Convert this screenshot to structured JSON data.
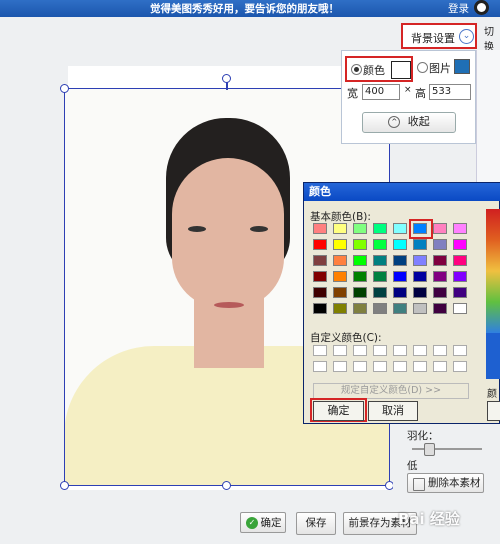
{
  "topbar": {
    "message": "觉得美图秀秀好用，要告诉您的朋友哦！",
    "login": "登录"
  },
  "bg_settings": {
    "button_label": "背景设置",
    "chevron": "⌄",
    "side_tab": "切换",
    "color_option": "颜色",
    "image_option": "图片",
    "width_label": "宽",
    "width_value": "400",
    "times": "×",
    "height_label": "高",
    "height_value": "533",
    "collapse_label": "收起"
  },
  "color_dialog": {
    "title": "颜色",
    "basic_label": "基本颜色(B):",
    "custom_label": "自定义颜色(C):",
    "define_label": "规定自定义颜色(D) >>",
    "ok_label": "确定",
    "cancel_label": "取消",
    "side_label": "颜色",
    "basic_colors": [
      "#ff8080",
      "#ffff80",
      "#80ff80",
      "#00ff80",
      "#80ffff",
      "#0080ff",
      "#ff80c0",
      "#ff80ff",
      "#ff0000",
      "#ffff00",
      "#80ff00",
      "#00ff40",
      "#00ffff",
      "#0080c0",
      "#8080c0",
      "#ff00ff",
      "#804040",
      "#ff8040",
      "#00ff00",
      "#008080",
      "#004080",
      "#8080ff",
      "#800040",
      "#ff0080",
      "#800000",
      "#ff8000",
      "#008000",
      "#008040",
      "#0000ff",
      "#0000a0",
      "#800080",
      "#8000ff",
      "#400000",
      "#804000",
      "#004000",
      "#004040",
      "#000080",
      "#000040",
      "#400040",
      "#400080",
      "#000000",
      "#808000",
      "#808040",
      "#808080",
      "#408080",
      "#c0c0c0",
      "#400040",
      "#ffffff"
    ]
  },
  "right_panel": {
    "feather_label": "羽化：",
    "low_label": "低",
    "delete_label": "删除本素材"
  },
  "bottom_bar": {
    "confirm_label": "确定",
    "save_label": "保存",
    "save_as_label": "前景存为素材"
  },
  "watermark": "Bai 经验"
}
